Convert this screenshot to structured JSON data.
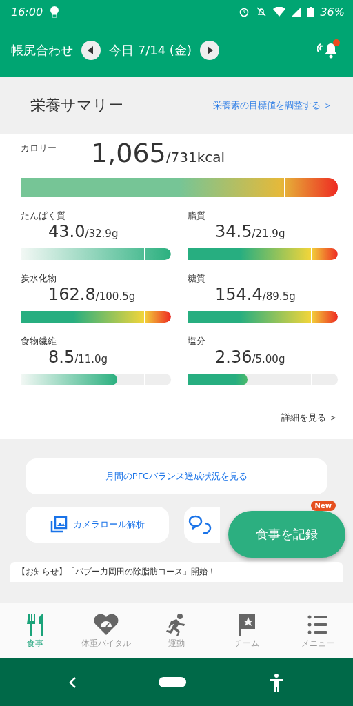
{
  "status_bar": {
    "time": "16:00",
    "battery": "36%"
  },
  "header": {
    "title": "帳尻合わせ",
    "date": "今日 7/14 (金)"
  },
  "summary": {
    "title": "栄養サマリー",
    "link": "栄養素の目標値を調整する ＞"
  },
  "calorie": {
    "label": "カロリー",
    "value": "1,065",
    "target": "/731kcal",
    "level": 1,
    "kind": "warm"
  },
  "nutrients": [
    {
      "label": "たんぱく質",
      "value": "43.0",
      "target": "/32.9g",
      "level": 1,
      "kind": "soft"
    },
    {
      "label": "脂質",
      "value": "34.5",
      "target": "/21.9g",
      "level": 1,
      "kind": "warm"
    },
    {
      "label": "炭水化物",
      "value": "162.8",
      "target": "/100.5g",
      "level": 1,
      "kind": "warm"
    },
    {
      "label": "糖質",
      "value": "154.4",
      "target": "/89.5g",
      "level": 1,
      "kind": "warm"
    },
    {
      "label": "食物繊維",
      "value": "8.5",
      "target": "/11.0g",
      "level": 0.64,
      "kind": "soft"
    },
    {
      "label": "塩分",
      "value": "2.36",
      "target": "/5.00g",
      "level": 0.4,
      "kind": "solid"
    }
  ],
  "details_link": "詳細を見る ＞",
  "pfc_button": "月間のPFCバランス達成状況を見る",
  "camera_button": "カメラロール解析",
  "fab": {
    "label": "食事を記録",
    "badge": "New"
  },
  "news": "【お知らせ】「パブー力岡田の除脂肪コース」開始！",
  "tabs": [
    {
      "label": "食事",
      "selected": true
    },
    {
      "label": "体重バイタル",
      "selected": false
    },
    {
      "label": "運動",
      "selected": false
    },
    {
      "label": "チーム",
      "selected": false
    },
    {
      "label": "メニュー",
      "selected": false
    }
  ]
}
